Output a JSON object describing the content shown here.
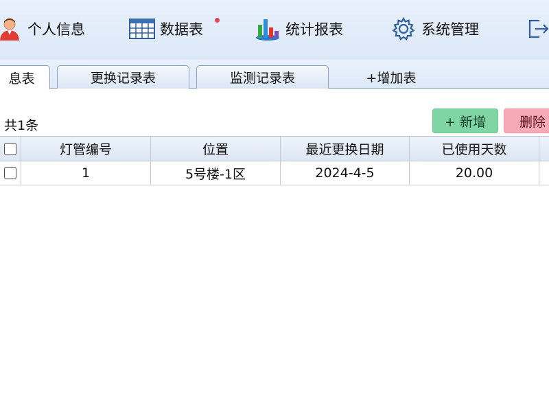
{
  "toolbar": {
    "items": [
      {
        "label": "个人信息",
        "icon": "person-icon"
      },
      {
        "label": "数据表",
        "icon": "table-icon",
        "badge": "red-dot"
      },
      {
        "label": "统计报表",
        "icon": "chart-icon"
      },
      {
        "label": "系统管理",
        "icon": "gear-icon"
      },
      {
        "label": "",
        "icon": "exit-icon"
      }
    ]
  },
  "tabs": {
    "items": [
      {
        "label": "息表",
        "active": true
      },
      {
        "label": "更换记录表",
        "active": false
      },
      {
        "label": "监测记录表",
        "active": false
      }
    ],
    "add_label": "+增加表"
  },
  "records": {
    "count_label": "共1条",
    "add_button": "+ 新增",
    "delete_button": "删除"
  },
  "grid": {
    "headers": [
      "灯管编号",
      "位置",
      "最近更换日期",
      "已使用天数"
    ],
    "rows": [
      {
        "cells": [
          "1",
          "5号楼-1区",
          "2024-4-5",
          "20.00"
        ]
      }
    ]
  },
  "colors": {
    "toolbar_bg": "#e3edfa",
    "add_button": "#7fd6a4",
    "delete_button": "#f8a9b6",
    "badge": "#e8445a"
  }
}
